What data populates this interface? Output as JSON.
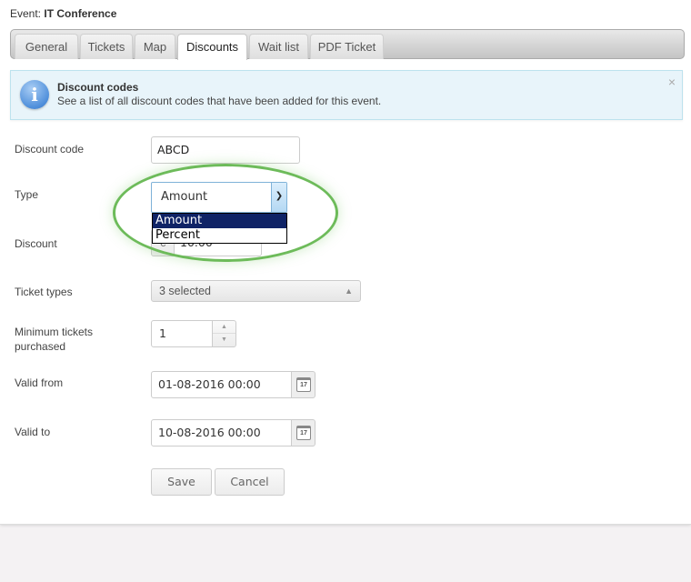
{
  "header": {
    "event_label": "Event:",
    "event_name": "IT Conference"
  },
  "tabs": [
    {
      "label": "General",
      "active": false
    },
    {
      "label": "Tickets",
      "active": false
    },
    {
      "label": "Map",
      "active": false
    },
    {
      "label": "Discounts",
      "active": true
    },
    {
      "label": "Wait list",
      "active": false
    },
    {
      "label": "PDF Ticket",
      "active": false
    }
  ],
  "info": {
    "icon": "info-icon",
    "title": "Discount codes",
    "text": "See a list of all discount codes that have been added for this event.",
    "close_glyph": "×"
  },
  "form": {
    "discount_code": {
      "label": "Discount code",
      "value": "ABCD"
    },
    "type": {
      "label": "Type",
      "value": "Amount",
      "options": [
        "Amount",
        "Percent"
      ],
      "highlighted_option": "Amount"
    },
    "discount": {
      "label": "Discount",
      "currency": "€",
      "value": "10.00"
    },
    "ticket_types": {
      "label": "Ticket types",
      "value": "3 selected"
    },
    "min_tickets": {
      "label_line1": "Minimum tickets",
      "label_line2": "purchased",
      "value": "1"
    },
    "valid_from": {
      "label": "Valid from",
      "value": "01-08-2016 00:00",
      "calendar_day": "17"
    },
    "valid_to": {
      "label": "Valid to",
      "value": "10-08-2016 00:00",
      "calendar_day": "17"
    }
  },
  "buttons": {
    "save": "Save",
    "cancel": "Cancel"
  },
  "colors": {
    "highlight_ring": "#6dbb5a",
    "dropdown_selected": "#0f2366",
    "info_bg": "#e8f4fa"
  }
}
